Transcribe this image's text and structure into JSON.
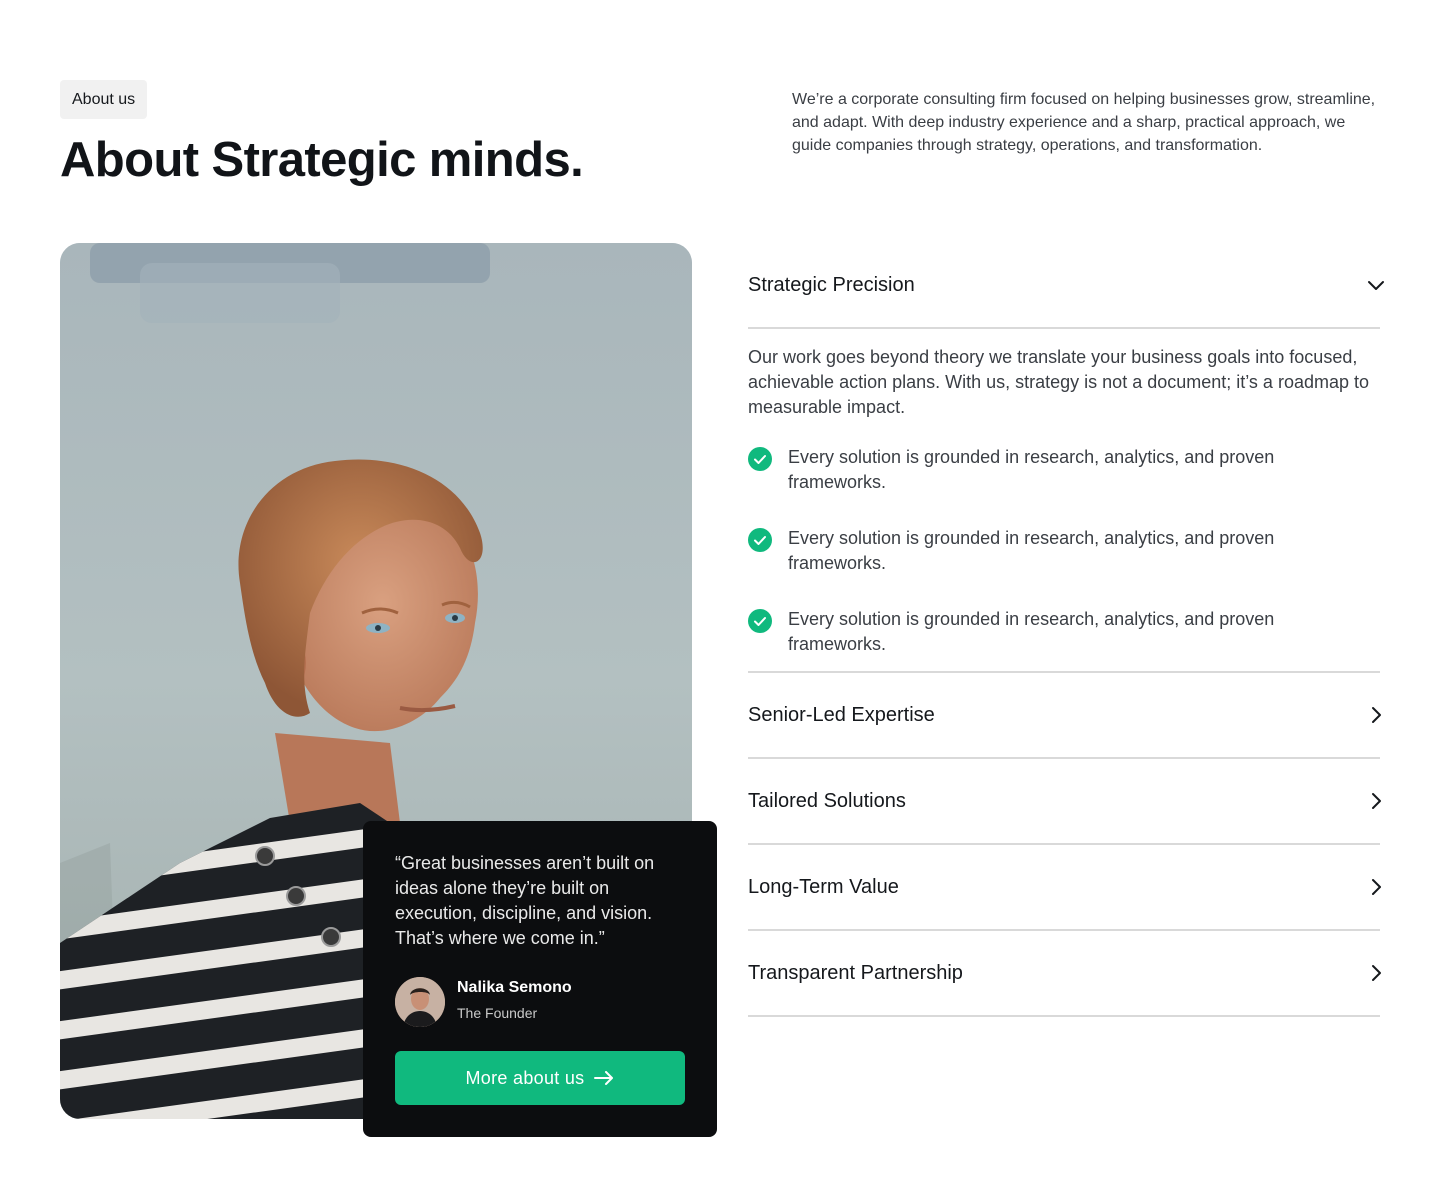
{
  "header": {
    "tag": "About us",
    "title": "About Strategic minds.",
    "intro": "We’re a corporate consulting firm focused on helping businesses grow, streamline, and adapt. With deep industry experience and a sharp, practical approach, we guide companies through strategy, operations, and transformation."
  },
  "quote_card": {
    "quote": "“Great businesses aren’t built on ideas alone they’re built on execution, discipline, and vision. That’s where we come in.”",
    "author_name": "Nalika Semono",
    "author_role": "The Founder",
    "cta_label": "More about us"
  },
  "accordion": {
    "items": [
      {
        "title": "Strategic Precision",
        "open": true,
        "description": "Our work goes beyond theory we translate your business goals into focused, achievable action plans. With us, strategy is not a document; it’s a roadmap to measurable impact.",
        "points": [
          "Every solution is grounded in research, analytics, and proven frameworks.",
          "Every solution is grounded in research, analytics, and proven frameworks.",
          "Every solution is grounded in research, analytics, and proven frameworks."
        ]
      },
      {
        "title": "Senior-Led Expertise",
        "open": false
      },
      {
        "title": "Tailored Solutions",
        "open": false
      },
      {
        "title": "Long-Term Value",
        "open": false
      },
      {
        "title": "Transparent Partnership",
        "open": false
      }
    ]
  },
  "colors": {
    "accent": "#10b97e",
    "card_background": "#0c0d0f",
    "tag_background": "#f1f1f1"
  },
  "icons": {
    "open_item": "chevron-down-icon",
    "closed_item": "chevron-right-icon",
    "point": "check-circle-icon",
    "cta": "arrow-right-icon"
  }
}
